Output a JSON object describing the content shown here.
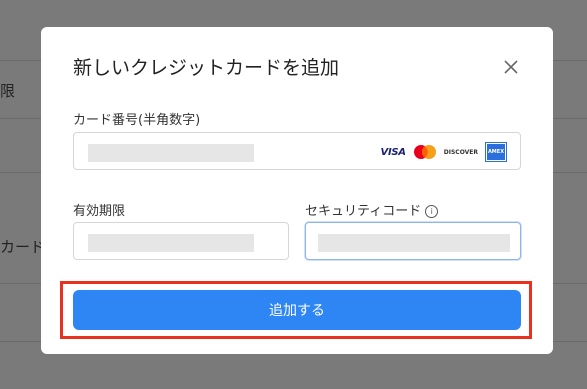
{
  "background": {
    "text_1": "限",
    "text_2": "カード"
  },
  "modal": {
    "title": "新しいクレジットカードを追加",
    "card_number_label": "カード番号(半角数字)",
    "expiry_label": "有効期限",
    "security_label": "セキュリティコード",
    "info_symbol": "i",
    "brands": {
      "visa": "VISA",
      "discover": "DISCOVER",
      "amex": "AMEX"
    },
    "submit_label": "追加する"
  },
  "colors": {
    "primary": "#2e86f5",
    "highlight": "#e8311f"
  }
}
